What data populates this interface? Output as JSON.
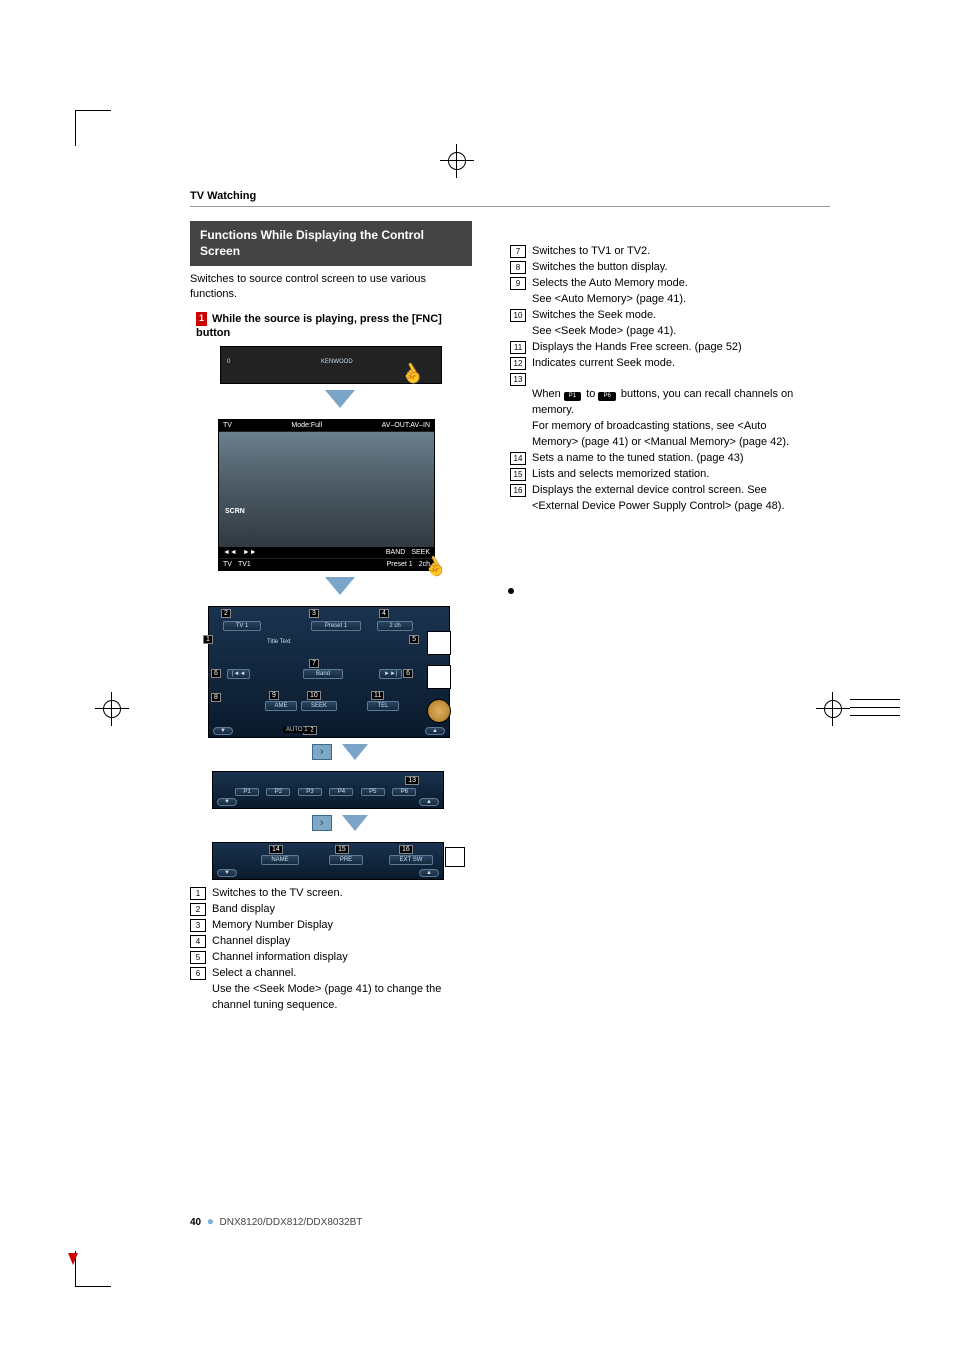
{
  "header_section": "TV Watching",
  "title_bar": "Functions While Displaying the Control Screen",
  "intro_text": "Switches to source control screen to use various functions.",
  "step1_num": "1",
  "step1_text": "While the source is playing, press the [FNC] button",
  "shot1": {
    "labels": [
      "0",
      "KENWOOD"
    ]
  },
  "shot2": {
    "top_left": "TV",
    "top_mid": "Mode:Full",
    "top_right": "AV–OUT:AV–IN",
    "scrn": "SCRN",
    "bottom": [
      "TV",
      "TV1",
      "Preset 1",
      "2ch"
    ],
    "bottom_icons": [
      "◄◄",
      "►►",
      "BAND",
      "SEEK"
    ]
  },
  "shot3": {
    "callouts": {
      "c1": "1",
      "c2": "2",
      "c3": "3",
      "c4": "4",
      "c5": "5",
      "c6": "6",
      "c7": "7",
      "c8": "8",
      "c9": "9",
      "c10": "10",
      "c11": "11",
      "c12": "12"
    },
    "tv1": "TV 1",
    "preset": "Preset 1",
    "ch": "2 ch",
    "title_text": "Title Text",
    "band": "Band",
    "ame": "AME",
    "seek": "SEEK",
    "tel": "TEL",
    "auto1": "AUTO 1",
    "skip_back": "|◄◄",
    "skip_fwd": "►►|"
  },
  "shot4": {
    "callout13": "13",
    "presets": [
      "P1",
      "P2",
      "P3",
      "P4",
      "P5",
      "P6"
    ]
  },
  "shot5": {
    "callout14": "14",
    "callout15": "15",
    "callout16": "16",
    "name": "NAME",
    "pre": "PRE",
    "extsw": "EXT SW"
  },
  "left_list": [
    {
      "n": "1",
      "t": "Switches to the TV screen."
    },
    {
      "n": "2",
      "t": "Band display"
    },
    {
      "n": "3",
      "t": "Memory Number Display"
    },
    {
      "n": "4",
      "t": "Channel display"
    },
    {
      "n": "5",
      "t": "Channel information display"
    },
    {
      "n": "6",
      "t": "Select a channel.\nUse the <Seek Mode> (page 41) to change the channel tuning sequence."
    }
  ],
  "right_list_a": [
    {
      "n": "7",
      "t": "Switches to TV1 or TV2."
    },
    {
      "n": "8",
      "t": "Switches the button display."
    },
    {
      "n": "9",
      "t": "Selects the Auto Memory mode.\nSee <Auto Memory> (page 41)."
    },
    {
      "n": "10",
      "t": "Switches the Seek mode.\nSee <Seek Mode> (page 41)."
    },
    {
      "n": "11",
      "t": "Displays the Hands Free screen. (page 52)"
    },
    {
      "n": "12",
      "t": "Indicates current Seek mode."
    }
  ],
  "right_13": {
    "n": "13",
    "pre": "When ",
    "p1": "P1",
    "mid": " to ",
    "p6": "P6",
    "post": " buttons, you can recall channels on memory.\nFor memory of broadcasting stations, see <Auto Memory> (page 41) or <Manual Memory> (page 42)."
  },
  "right_list_b": [
    {
      "n": "14",
      "t": "Sets a name to the tuned station. (page 43)"
    },
    {
      "n": "15",
      "t": "Lists and selects memorized station."
    },
    {
      "n": "16",
      "t": "Displays the external device control screen. See <External Device Power Supply Control> (page 48)."
    }
  ],
  "footer_page": "40",
  "footer_model": "DNX8120/DDX812/DDX8032BT"
}
